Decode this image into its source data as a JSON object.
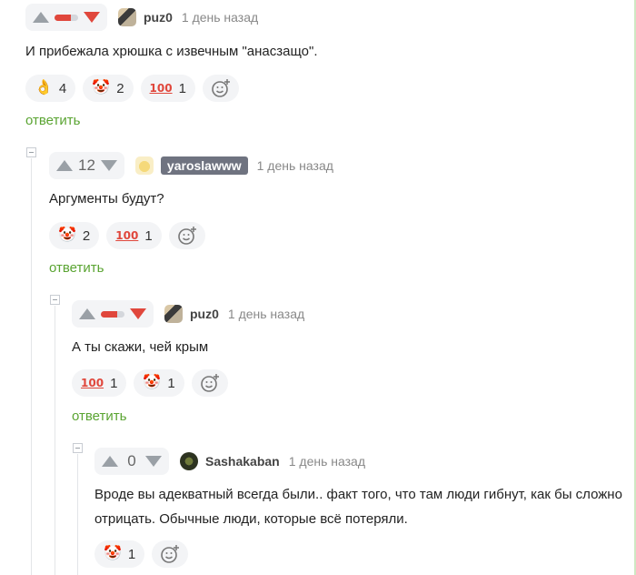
{
  "comments": [
    {
      "user": "puz0",
      "time": "1 день назад",
      "score": "",
      "text": [
        "И прибежала хрюшка с извечным \"анасзащо\"."
      ],
      "reactions": [
        {
          "icon": "ok-hand-emoji",
          "glyph": "👌",
          "count": "4"
        },
        {
          "icon": "clown-emoji",
          "glyph": "🤡",
          "count": "2"
        },
        {
          "icon": "hundred-emoji",
          "glyph": "100",
          "count": "1"
        }
      ],
      "reply": "ответить"
    },
    {
      "user": "yaroslawww",
      "time": "1 день назад",
      "score": "12",
      "text": [
        "Аргументы будут?"
      ],
      "reactions": [
        {
          "icon": "clown-emoji",
          "glyph": "🤡",
          "count": "2"
        },
        {
          "icon": "hundred-emoji",
          "glyph": "100",
          "count": "1"
        }
      ],
      "reply": "ответить"
    },
    {
      "user": "puz0",
      "time": "1 день назад",
      "score": "",
      "text": [
        "А ты скажи, чей крым"
      ],
      "reactions": [
        {
          "icon": "hundred-emoji",
          "glyph": "100",
          "count": "1"
        },
        {
          "icon": "clown-emoji",
          "glyph": "🤡",
          "count": "1"
        }
      ],
      "reply": "ответить"
    },
    {
      "user": "Sashakaban",
      "time": "1 день назад",
      "score": "0",
      "text": [
        "Вроде вы адекватный всегда были.. факт того, что там люди гибнут, как бы сложно",
        "отрицать. Обычные люди, которые всё потеряли."
      ],
      "reactions": [
        {
          "icon": "clown-emoji",
          "glyph": "🤡",
          "count": "1"
        }
      ],
      "reply": ""
    }
  ],
  "colors": {
    "accent_green": "#5aa432",
    "downvote_red": "#e0473c",
    "chip_bg": "#f3f4f6"
  }
}
